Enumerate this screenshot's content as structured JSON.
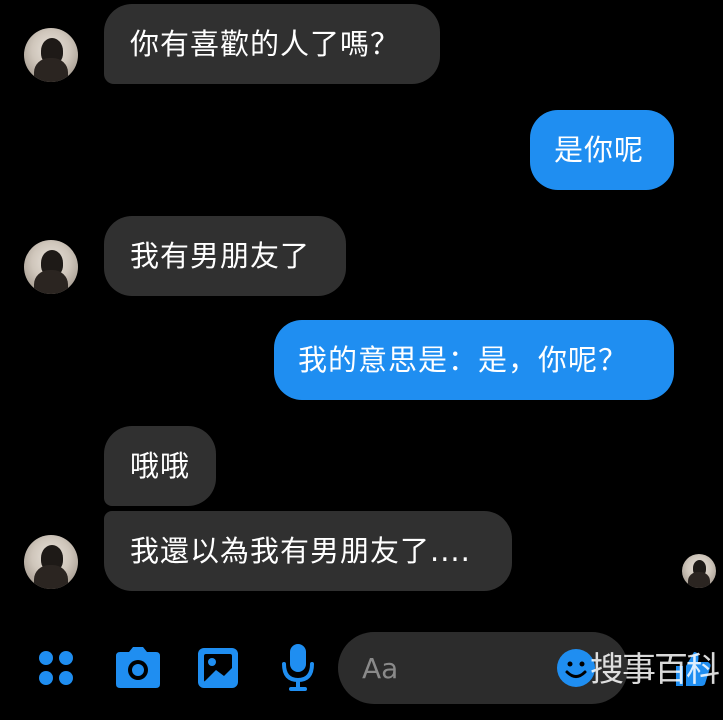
{
  "colors": {
    "background": "#000000",
    "incoming_bubble": "#303030",
    "outgoing_bubble": "#1f8ef1",
    "accent": "#1f8ef1",
    "input_background": "#2c2c2c"
  },
  "messages": [
    {
      "direction": "incoming",
      "text": "你有喜歡的人了嗎？",
      "avatar": "contact-avatar"
    },
    {
      "direction": "outgoing",
      "text": "是你呢"
    },
    {
      "direction": "incoming",
      "text": "我有男朋友了",
      "avatar": "contact-avatar"
    },
    {
      "direction": "outgoing",
      "text": "我的意思是：是，你呢？"
    },
    {
      "direction": "incoming",
      "text": "哦哦"
    },
    {
      "direction": "incoming",
      "text": "我還以為我有男朋友了....",
      "avatar": "contact-avatar"
    }
  ],
  "composer": {
    "placeholder": "Aa",
    "icons": [
      "apps-icon",
      "camera-icon",
      "gallery-icon",
      "microphone-icon",
      "emoji-icon",
      "like-icon"
    ]
  },
  "watermark": "搜事百科"
}
